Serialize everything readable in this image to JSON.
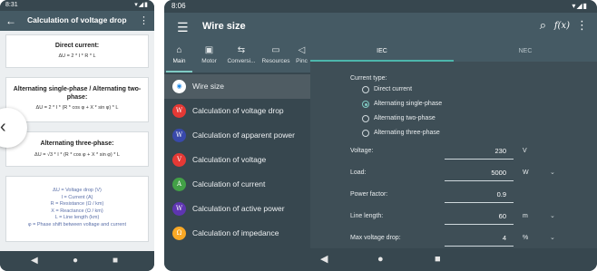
{
  "phone": {
    "status_time": "8:31",
    "title": "Calculation of voltage drop",
    "cards": [
      {
        "title": "Direct current:",
        "formula": "ΔU = 2 * I * R * L"
      },
      {
        "title": "Alternating single-phase / Alternating two-phase:",
        "formula": "ΔU = 2 * I * (R * cos φ + X * sin φ) * L"
      },
      {
        "title": "Alternating three-phase:",
        "formula": "ΔU = √3 * I * (R * cos φ + X * sin φ) * L"
      }
    ],
    "legend": [
      "ΔU = Voltage drop (V)",
      "I = Current (A)",
      "R = Resistance (Ω / km)",
      "X = Reactance (Ω / km)",
      "L = Line length (km)",
      "φ = Phase shift between voltage and current"
    ]
  },
  "tablet": {
    "status_time": "8:06",
    "title": "Wire size",
    "nav_tabs": [
      {
        "label": "Main",
        "icon": "home-icon"
      },
      {
        "label": "Motor",
        "icon": "motor-icon"
      },
      {
        "label": "Conversi...",
        "icon": "conversion-icon"
      },
      {
        "label": "Resources",
        "icon": "folder-icon"
      },
      {
        "label": "Pinc",
        "icon": "pinout-icon"
      }
    ],
    "menu_items": [
      {
        "label": "Wire size",
        "icon": "⊙",
        "color": "#26a69a"
      },
      {
        "label": "Calculation of voltage drop",
        "icon": "W",
        "color": "#e53935"
      },
      {
        "label": "Calculation of apparent power",
        "icon": "W",
        "color": "#3949ab"
      },
      {
        "label": "Calculation of voltage",
        "icon": "V",
        "color": "#e53935"
      },
      {
        "label": "Calculation of current",
        "icon": "A",
        "color": "#43a047"
      },
      {
        "label": "Calculation of active power",
        "icon": "W",
        "color": "#5e35b1"
      },
      {
        "label": "Calculation of impedance",
        "icon": "Ω",
        "color": "#f9a825"
      }
    ],
    "content_tabs": [
      "IEC",
      "NEC"
    ],
    "current_type_label": "Current type:",
    "current_types": [
      {
        "label": "Direct current",
        "selected": false
      },
      {
        "label": "Alternating single-phase",
        "selected": true
      },
      {
        "label": "Alternating two-phase",
        "selected": false
      },
      {
        "label": "Alternating three-phase",
        "selected": false
      }
    ],
    "fields": [
      {
        "label": "Voltage:",
        "value": "230",
        "unit": "V",
        "has_dropdown": false
      },
      {
        "label": "Load:",
        "value": "5000",
        "unit": "W",
        "has_dropdown": true
      },
      {
        "label": "Power factor:",
        "value": "0.9",
        "unit": "",
        "has_dropdown": false
      },
      {
        "label": "Line length:",
        "value": "60",
        "unit": "m",
        "has_dropdown": true
      },
      {
        "label": "Max voltage drop:",
        "value": "4",
        "unit": "%",
        "has_dropdown": true
      }
    ]
  }
}
